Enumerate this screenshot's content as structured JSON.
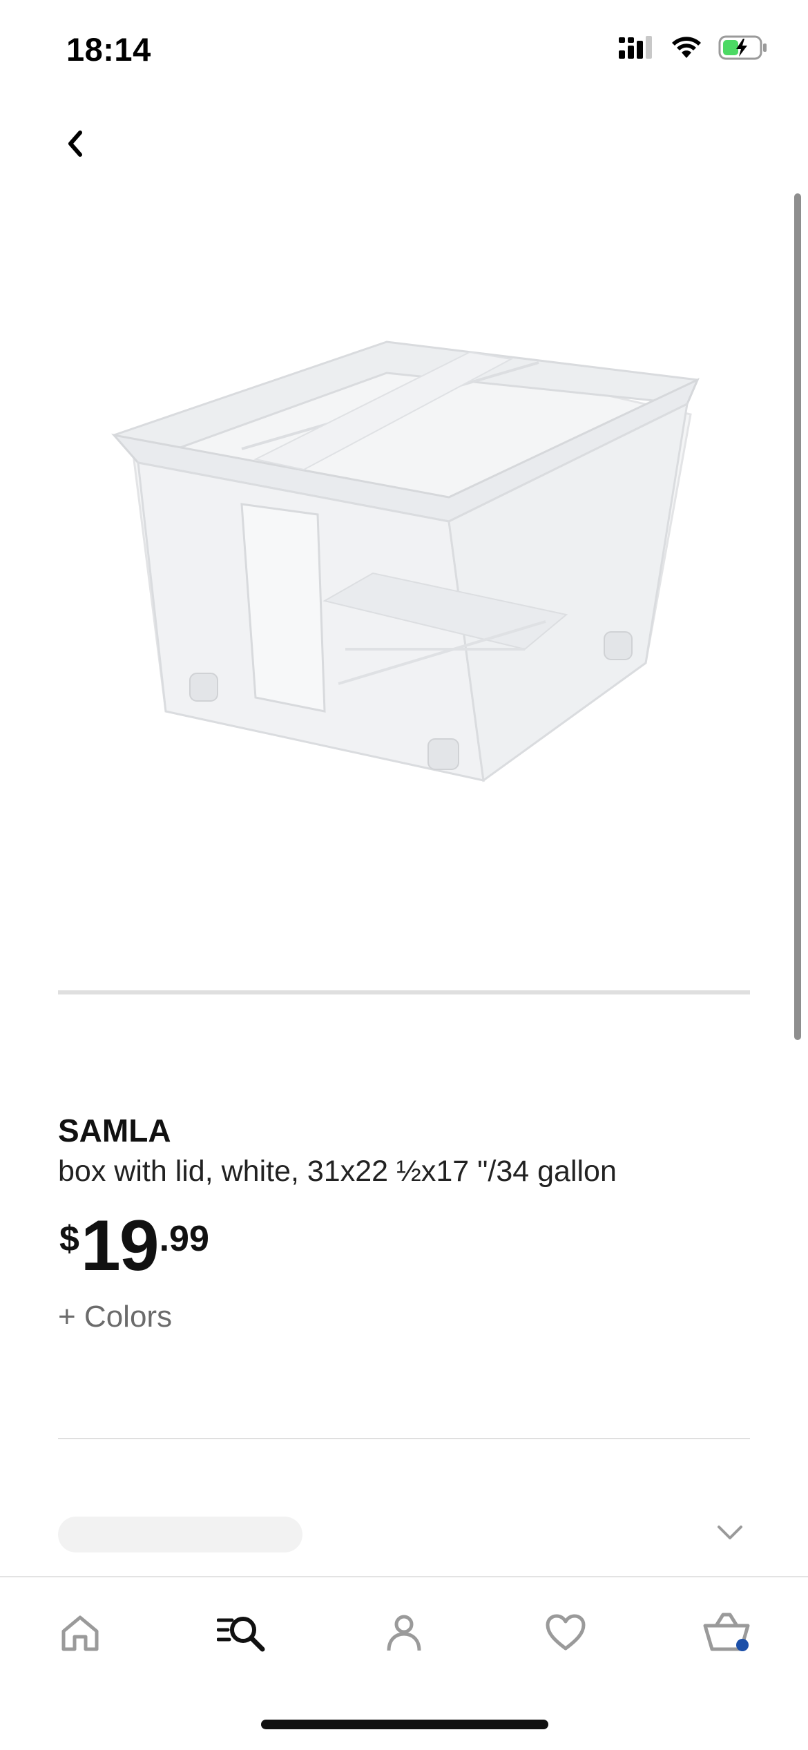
{
  "status_bar": {
    "time": "18:14"
  },
  "product": {
    "name": "SAMLA",
    "description": "box with lid, white, 31x22 ½x17 \"/34 gallon",
    "price": {
      "currency": "$",
      "whole": "19",
      "cents": ".99"
    },
    "colors_link": "+ Colors",
    "image_icon": "clear-storage-box"
  },
  "nav": {
    "items": [
      {
        "icon": "home-icon",
        "active": false
      },
      {
        "icon": "search-icon",
        "active": true
      },
      {
        "icon": "profile-icon",
        "active": false
      },
      {
        "icon": "heart-icon",
        "active": false
      },
      {
        "icon": "basket-icon",
        "active": false,
        "badge_color": "#1c4fa8"
      }
    ]
  },
  "colors": {
    "text": "#111111",
    "muted": "#6b6b6b",
    "divider": "#dfdfdf",
    "badge": "#1c4fa8",
    "battery": "#4cd964"
  }
}
